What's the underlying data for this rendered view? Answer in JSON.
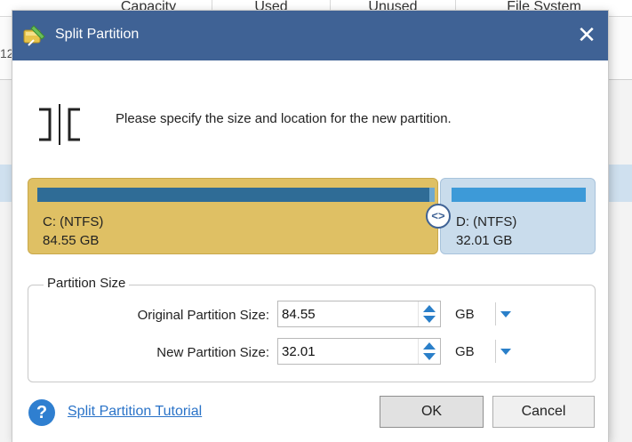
{
  "background": {
    "columns": [
      "Capacity",
      "Used",
      "Unused",
      "File System"
    ],
    "row_fragment": "12"
  },
  "dialog": {
    "title": "Split Partition",
    "close_glyph": "✕",
    "description": "Please specify the size and location for the new partition.",
    "partitions": [
      {
        "name": "C: (NTFS)",
        "size": "84.55 GB",
        "color": "#dfc064"
      },
      {
        "name": "D: (NTFS)",
        "size": "32.01 GB",
        "color": "#c9dcec"
      }
    ],
    "handle_glyph": "<>",
    "partition_size_group": {
      "label": "Partition Size",
      "original": {
        "label": "Original Partition Size:",
        "value": "84.55",
        "unit": "GB"
      },
      "new": {
        "label": "New Partition Size:",
        "value": "32.01",
        "unit": "GB"
      }
    },
    "help_glyph": "?",
    "tutorial_link": "Split Partition Tutorial",
    "ok_label": "OK",
    "cancel_label": "Cancel"
  },
  "colors": {
    "titlebar": "#3f6295",
    "accent": "#2a7fc9",
    "link": "#2a73c8"
  },
  "icons": [
    "split-partition-icon",
    "close-icon",
    "split-icon",
    "resize-handle-icon",
    "spin-up-icon",
    "spin-down-icon",
    "dropdown-icon",
    "help-icon"
  ]
}
